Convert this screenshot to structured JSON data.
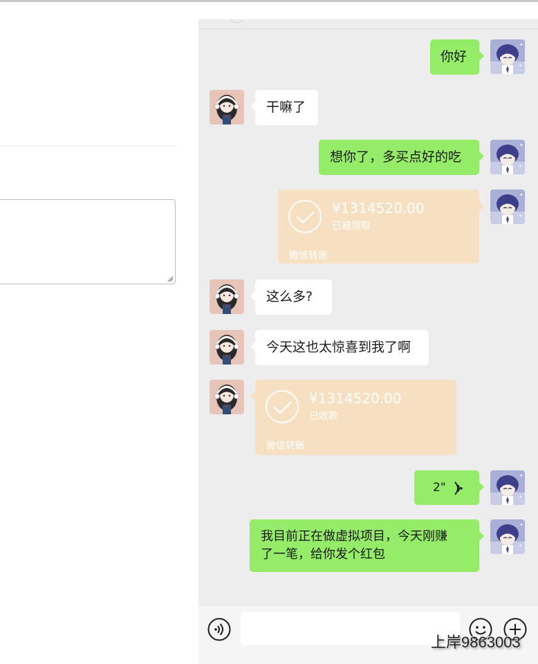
{
  "messages": [
    {
      "side": "right",
      "type": "text",
      "text": "你好"
    },
    {
      "side": "left",
      "type": "text",
      "text": "干嘛了"
    },
    {
      "side": "right",
      "type": "text",
      "text": "想你了，多买点好的吃"
    },
    {
      "side": "right",
      "type": "transfer",
      "amount": "¥1314520.00",
      "status": "已被领取",
      "label": "微信转账"
    },
    {
      "side": "left",
      "type": "text",
      "text": "这么多?"
    },
    {
      "side": "left",
      "type": "text",
      "text": "今天这也太惊喜到我了啊"
    },
    {
      "side": "left",
      "type": "transfer",
      "amount": "¥1314520.00",
      "status": "已收款",
      "label": "微信转账"
    },
    {
      "side": "right",
      "type": "voice",
      "duration": "2\""
    },
    {
      "side": "right",
      "type": "text",
      "lines": [
        "我目前正在做虚拟项目，今天刚赚",
        "了一笔，给你发个红包"
      ]
    }
  ],
  "input_bar": {
    "left_icon": "voice-input-icon",
    "right_icons": [
      "emoji-icon",
      "plus-icon"
    ],
    "value": ""
  },
  "watermark": "上岸9863003",
  "colors": {
    "chat_bg": "#ededed",
    "green_bubble": "#95ec69",
    "white_bubble": "#ffffff",
    "transfer_bg": "#f7e0c2"
  }
}
